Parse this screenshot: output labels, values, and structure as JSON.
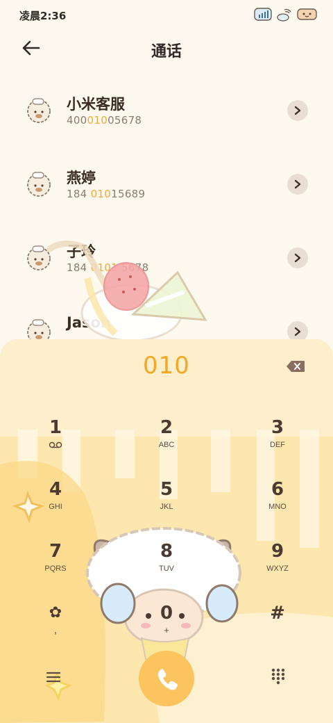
{
  "status_bar": {
    "time": "凌晨2:36"
  },
  "header": {
    "title": "通话"
  },
  "contacts": [
    {
      "name": "小米客服",
      "number_pre": "400",
      "number_hl": "010",
      "number_post": "05678"
    },
    {
      "name": "燕婷",
      "number_pre": "184 ",
      "number_hl": "010",
      "number_post": "15689"
    },
    {
      "name": "子玲",
      "number_pre": "184 ",
      "number_hl": "0101",
      "number_post": " 5678"
    },
    {
      "name": "Jason",
      "number_pre": "",
      "number_hl": "",
      "number_post": ""
    }
  ],
  "dialer": {
    "input": "010",
    "keys": [
      {
        "digit": "1",
        "sub": ""
      },
      {
        "digit": "2",
        "sub": "ABC"
      },
      {
        "digit": "3",
        "sub": "DEF"
      },
      {
        "digit": "4",
        "sub": "GHI"
      },
      {
        "digit": "5",
        "sub": "JKL"
      },
      {
        "digit": "6",
        "sub": "MNO"
      },
      {
        "digit": "7",
        "sub": "PQRS"
      },
      {
        "digit": "8",
        "sub": "TUV"
      },
      {
        "digit": "9",
        "sub": "WXYZ"
      },
      {
        "digit": "✿",
        "sub": ","
      },
      {
        "digit": "0",
        "sub": "+"
      },
      {
        "digit": "#",
        "sub": ""
      }
    ]
  },
  "colors": {
    "accent": "#f5a623",
    "call": "#fbc45e",
    "background": "#fdf9ef"
  },
  "icons": {
    "back": "arrow-left-icon",
    "detail": "chevron-right-icon",
    "delete": "backspace-icon",
    "call": "phone-icon",
    "menu": "menu-icon",
    "keypad": "dialpad-icon"
  }
}
